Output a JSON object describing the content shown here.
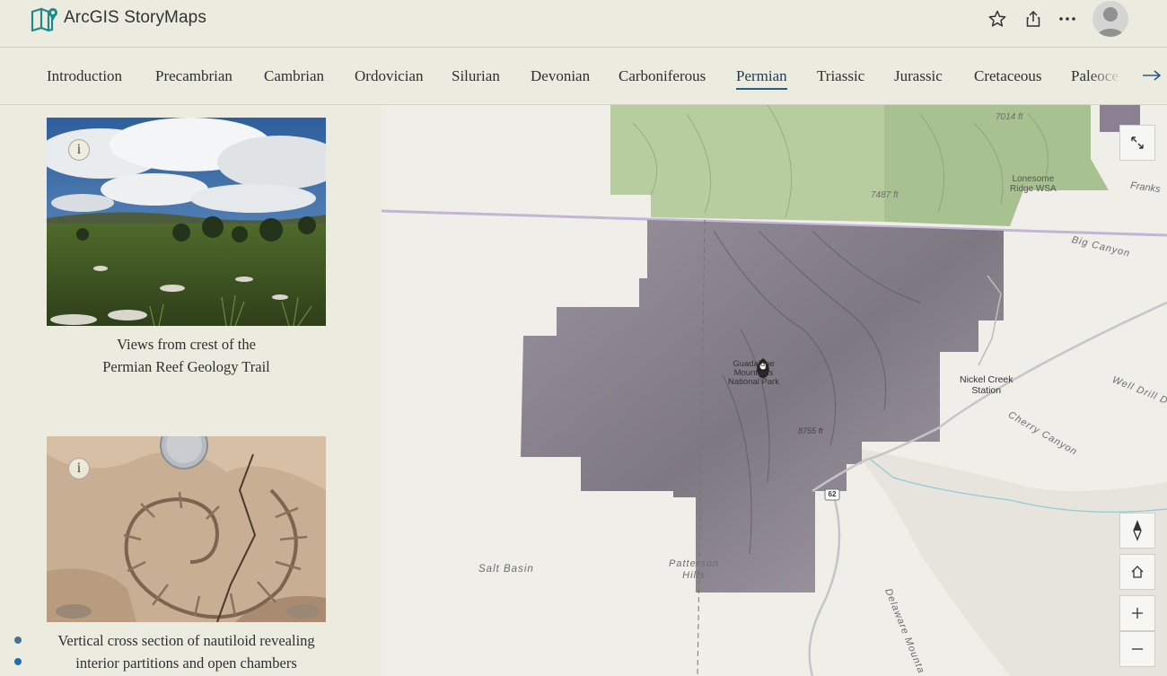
{
  "header": {
    "brand": "ArcGIS StoryMaps",
    "icons": [
      "storymaps-logo-icon",
      "star-icon",
      "share-icon",
      "more-icon",
      "avatar"
    ]
  },
  "nav": {
    "tabs": [
      {
        "label": "Introduction"
      },
      {
        "label": "Precambrian"
      },
      {
        "label": "Cambrian"
      },
      {
        "label": "Ordovician"
      },
      {
        "label": "Silurian"
      },
      {
        "label": "Devonian"
      },
      {
        "label": "Carboniferous"
      },
      {
        "label": "Permian",
        "active": true
      },
      {
        "label": "Triassic"
      },
      {
        "label": "Jurassic"
      },
      {
        "label": "Cretaceous"
      },
      {
        "label": "Paleoce"
      }
    ],
    "next_icon": "arrow-right-icon"
  },
  "story": {
    "items": [
      {
        "image": "landscape-photo",
        "info": "i",
        "caption_line1": "Views from crest of the",
        "caption_line2": "Permian Reef Geology Trail"
      },
      {
        "image": "nautiloid-fossil-photo",
        "info": "i",
        "caption_line1": "Vertical cross section of nautiloid revealing",
        "caption_line2": "interior partitions and open chambers"
      }
    ],
    "accent": "#2a5b85"
  },
  "map": {
    "labels": {
      "elev_7014": "7014 ft",
      "lonesome": "Lonesome\nRidge WSA",
      "franks": "Franks",
      "elev_7487": "7487 ft",
      "big_canyon": "Big Canyon",
      "park_line1": "Guadalupe",
      "park_line2": "Mountains",
      "park_line3": "National Park",
      "nickel_line1": "Nickel Creek",
      "nickel_line2": "Station",
      "well_drill": "Well Drill D",
      "cherry": "Cherry Canyon",
      "elev_8755": "8755 ft",
      "route": "62",
      "salt_basin": "Salt Basin",
      "patterson_line1": "Patterson",
      "patterson_line2": "Hills",
      "delaware": "Delaware Mounta"
    },
    "controls": [
      "expand-icon",
      "compass-icon",
      "home-icon",
      "zoom-in-icon",
      "zoom-out-icon"
    ],
    "colors": {
      "park": "#9e96a6",
      "forest": "#a9c493",
      "boundary": "#b9a8d0"
    }
  }
}
